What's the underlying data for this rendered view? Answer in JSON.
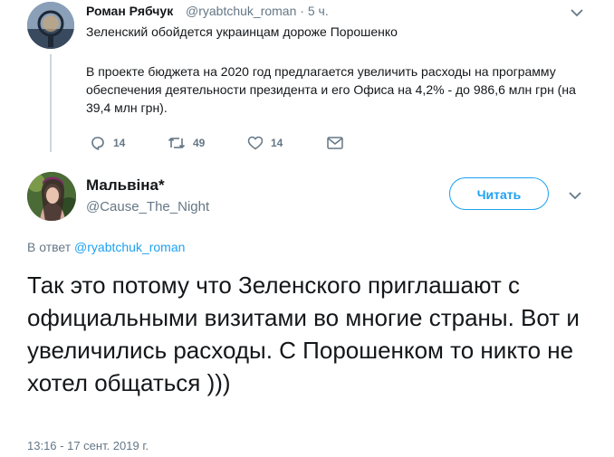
{
  "parent_tweet": {
    "author_name": "Роман Рябчук",
    "author_handle": "@ryabtchuk_roman",
    "time": "5 ч.",
    "headline": "Зеленский обойдется украинцам дороже Порошенко",
    "body": "В проекте бюджета на 2020 год предлагается увеличить расходы на программу обеспечения деятельности президента и его Офиса на 4,2% - до 986,6 млн грн (на 39,4 млн грн).",
    "reply_count": "14",
    "retweet_count": "49",
    "like_count": "14",
    "icons": [
      "reply-icon",
      "retweet-icon",
      "like-icon",
      "message-icon",
      "chevron-down-icon"
    ]
  },
  "main_tweet": {
    "author_name": "Мальвіна*",
    "author_handle": "@Cause_The_Night",
    "follow_label": "Читать",
    "reply_prefix": "В ответ",
    "reply_to": "@ryabtchuk_roman",
    "text": "Так это потому что Зеленского приглашают с официальными визитами во многие страны. Вот и увеличились расходы. С Порошенком то никто не хотел общаться )))",
    "timestamp": "13:16 - 17 сент. 2019 г."
  },
  "colors": {
    "accent": "#1da1f2",
    "text": "#14171a",
    "muted": "#657786",
    "thread_line": "#ccd6dd"
  }
}
